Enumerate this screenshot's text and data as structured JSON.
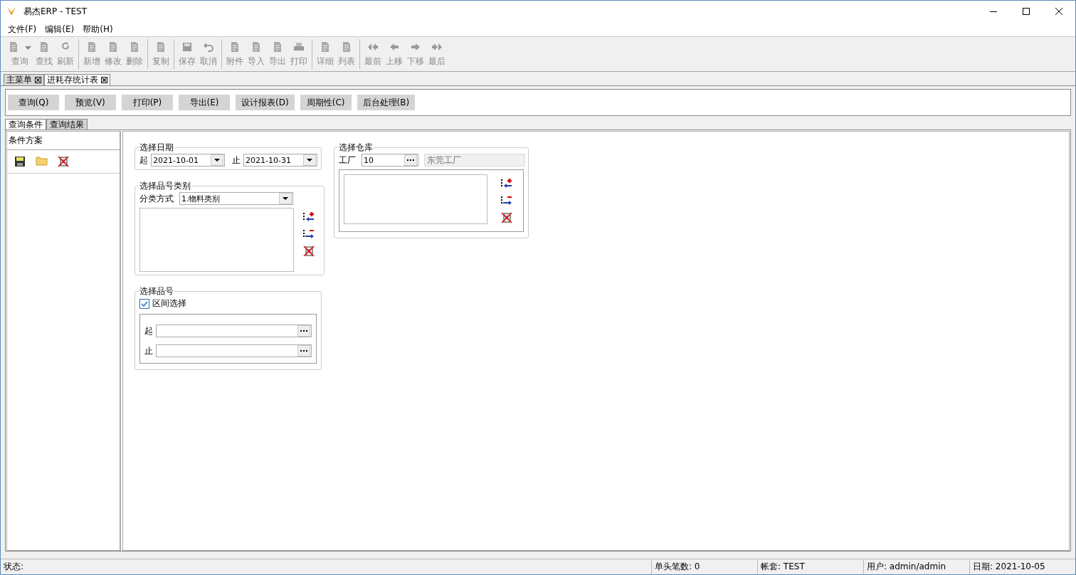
{
  "window": {
    "title": "易杰ERP - TEST"
  },
  "menu": [
    "文件(F)",
    "编辑(E)",
    "帮助(H)"
  ],
  "toolbar": [
    {
      "buttons": [
        {
          "label": "查询",
          "disabled": true,
          "dropdown": true
        },
        {
          "label": "查找",
          "disabled": true,
          "dropdown": false
        },
        {
          "label": "刷新",
          "disabled": true,
          "dropdown": false
        }
      ]
    },
    {
      "buttons": [
        {
          "label": "新增",
          "disabled": true,
          "dropdown": false
        },
        {
          "label": "修改",
          "disabled": true,
          "dropdown": false
        },
        {
          "label": "删除",
          "disabled": true,
          "dropdown": false
        }
      ]
    },
    {
      "buttons": [
        {
          "label": "复制",
          "disabled": true,
          "dropdown": false
        }
      ]
    },
    {
      "buttons": [
        {
          "label": "保存",
          "disabled": true,
          "dropdown": false
        },
        {
          "label": "取消",
          "disabled": true,
          "dropdown": false
        }
      ]
    },
    {
      "buttons": [
        {
          "label": "附件",
          "disabled": true,
          "dropdown": false
        },
        {
          "label": "导入",
          "disabled": true,
          "dropdown": false
        },
        {
          "label": "导出",
          "disabled": true,
          "dropdown": false
        },
        {
          "label": "打印",
          "disabled": true,
          "dropdown": false
        }
      ]
    },
    {
      "buttons": [
        {
          "label": "详细",
          "disabled": true,
          "dropdown": false
        },
        {
          "label": "列表",
          "disabled": true,
          "dropdown": false
        }
      ]
    },
    {
      "buttons": [
        {
          "label": "最前",
          "disabled": true,
          "dropdown": false
        },
        {
          "label": "上移",
          "disabled": true,
          "dropdown": false
        },
        {
          "label": "下移",
          "disabled": true,
          "dropdown": false
        },
        {
          "label": "最后",
          "disabled": true,
          "dropdown": false
        }
      ]
    }
  ],
  "doc_tabs": [
    {
      "label": "主菜单",
      "selected": false
    },
    {
      "label": "进耗存统计表",
      "selected": true
    }
  ],
  "actions": [
    "查询(Q)",
    "预览(V)",
    "打印(P)",
    "导出(E)",
    "设计报表(D)",
    "周期性(C)",
    "后台处理(B)"
  ],
  "sub_tabs": [
    {
      "label": "查询条件",
      "selected": true
    },
    {
      "label": "查询结果",
      "selected": false
    }
  ],
  "scheme_panel": {
    "title": "条件方案"
  },
  "date_group": {
    "title": "选择日期",
    "from_label": "起",
    "from": "2021-10-01",
    "to_label": "止",
    "to": "2021-10-31"
  },
  "category_group": {
    "title": "选择品号类别",
    "method_label": "分类方式",
    "method": "1.物料类别"
  },
  "item_group": {
    "title": "选择品号",
    "range": {
      "label": "区间选择",
      "checked": true
    },
    "from_label": "起",
    "to_label": "止"
  },
  "warehouse_group": {
    "title": "选择仓库",
    "factory_label": "工厂",
    "factory_code": "10",
    "factory_name": "东莞工厂"
  },
  "status_bar": {
    "status": "状态:",
    "count": "单头笔数: 0",
    "account": "帐套: TEST",
    "user": "用户: admin/admin",
    "date": "日期: 2021-10-05"
  }
}
